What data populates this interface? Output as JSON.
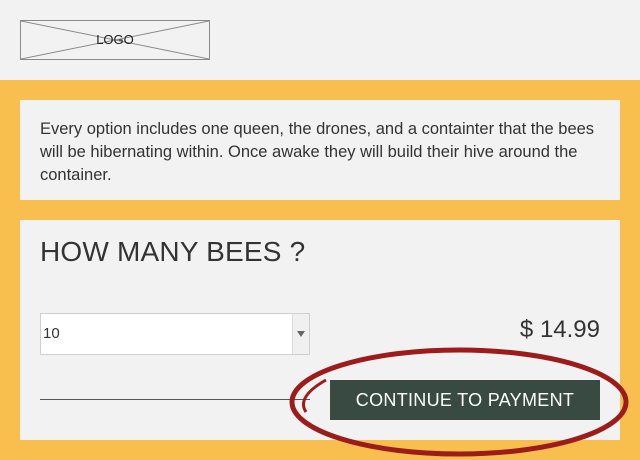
{
  "header": {
    "logo_label": "LOGO"
  },
  "info": {
    "text": "Every option includes one queen, the drones, and a containter that the bees will be hibernating within. Once awake they will build their hive around the container."
  },
  "order": {
    "title": "HOW MANY BEES ?",
    "quantity_value": "10",
    "price": "$ 14.99",
    "continue_label": "CONTINUE TO PAYMENT"
  },
  "colors": {
    "band": "#f8bf4f",
    "card": "#f2f2f2",
    "button": "#384a42",
    "highlight": "#9c1c1c"
  }
}
